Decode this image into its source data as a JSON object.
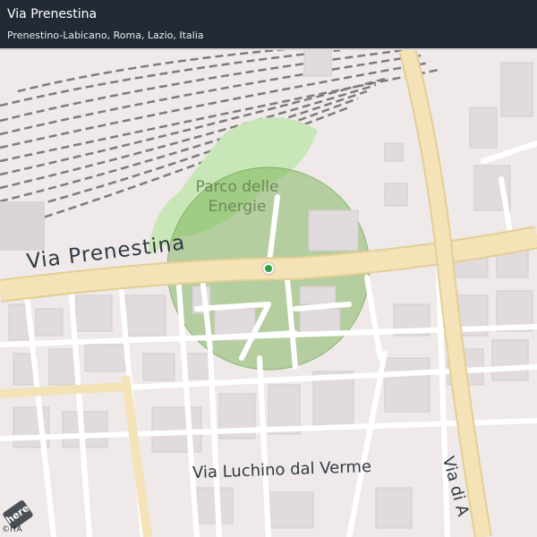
{
  "header": {
    "title": "Via Prenestina",
    "subtitle": "Prenestino-Labicano, Roma, Lazio, Italia"
  },
  "map": {
    "labels": {
      "main_street": "Via  Prenestina",
      "lower_street": "Via  Luchino  dal  Verme",
      "right_street": "Via di A",
      "park": "Parco delle Energie"
    },
    "colors": {
      "background": "#efe9ea",
      "road": "#ffffff",
      "major_road": "#f3e3b6",
      "park": "#c9e6b8",
      "radius_fill": "#6fae45",
      "railway": "#7c7c7c",
      "marker": "#2aa34a",
      "header_bg": "#222b35"
    },
    "marker_icon": "location-dot-icon"
  },
  "footer": {
    "logo": "here",
    "attribution": "©ITA"
  }
}
